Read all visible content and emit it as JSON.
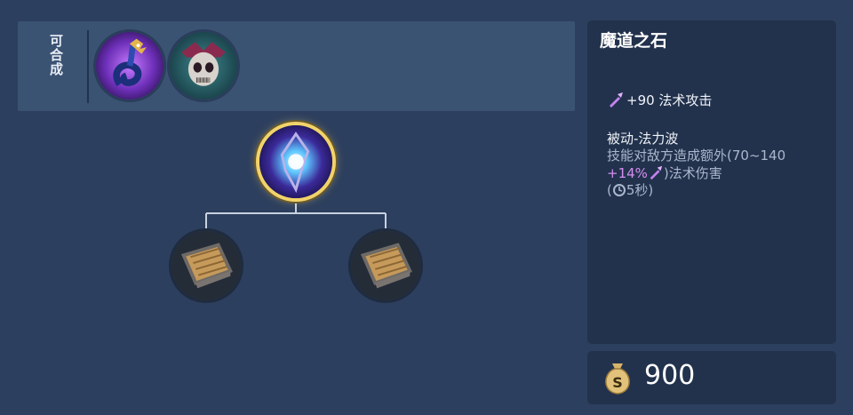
{
  "combo": {
    "label": "可合成",
    "items": [
      {
        "icon": "serpent-staff-icon"
      },
      {
        "icon": "skull-mask-icon"
      }
    ]
  },
  "tree": {
    "main_item": {
      "icon": "magic-orb-icon"
    },
    "components": [
      {
        "icon": "wooden-book-icon"
      },
      {
        "icon": "wooden-book-icon"
      }
    ]
  },
  "detail": {
    "name": "魔道之石",
    "stat": "+90 法术攻击",
    "passive_title": "被动-法力波",
    "passive_line1": "技能对敌方造成额外(70~140",
    "passive_scale": "+14%",
    "passive_line2_tail": ")法术伤害",
    "cooldown_open": "(",
    "cooldown": "5秒)"
  },
  "price": {
    "value": "900"
  },
  "colors": {
    "background": "#2d3f5e",
    "panel": "#22324d",
    "highlight": "#d58ef0",
    "gold_ring": "#f2d36a"
  }
}
